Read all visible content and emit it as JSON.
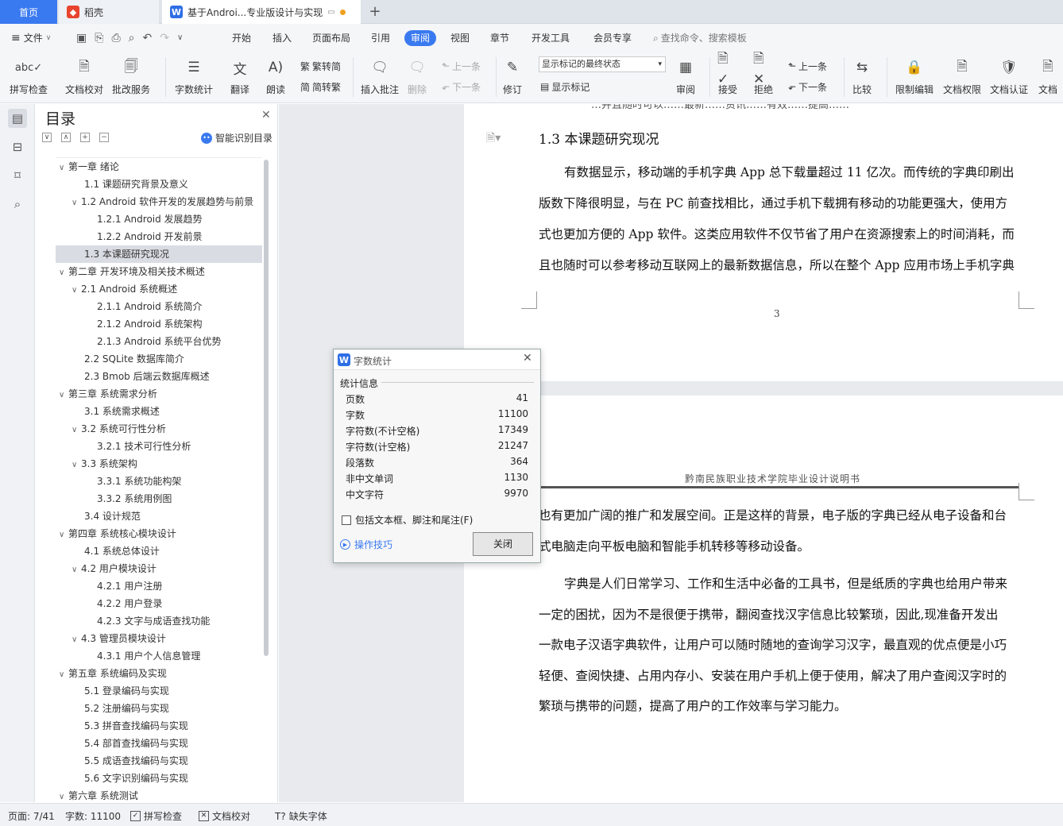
{
  "tabs": {
    "home": "首页",
    "t2": "稻壳",
    "t3": "基于Androi...专业版设计与实现"
  },
  "menu": {
    "file": "文件",
    "items": [
      "开始",
      "插入",
      "页面布局",
      "引用",
      "审阅",
      "视图",
      "章节",
      "开发工具",
      "会员专享"
    ],
    "search": "查找命令、搜索模板"
  },
  "ribbon": {
    "spell": "拼写检查",
    "proof": "文档校对",
    "batch": "批改服务",
    "wordcount": "字数统计",
    "translate": "翻译",
    "read": "朗读",
    "t2s": "繁转简",
    "s2t": "简转繁",
    "insert_comment": "插入批注",
    "delete": "删除",
    "prev": "上一条",
    "next": "下一条",
    "revise": "修订",
    "markup_state": "显示标记的最终状态",
    "show_markup": "显示标记",
    "review": "审阅",
    "accept": "接受",
    "reject": "拒绝",
    "prev2": "上一条",
    "next2": "下一条",
    "compare": "比较",
    "restrict": "限制编辑",
    "perm": "文档权限",
    "auth": "文档认证",
    "doc_more": "文档"
  },
  "toc": {
    "title": "目录",
    "smart": "智能识别目录",
    "items": [
      {
        "text": "第一章 绪论",
        "level": 0,
        "caret": "v"
      },
      {
        "text": "1.1 课题研究背景及意义",
        "level": 1,
        "caret": ""
      },
      {
        "text": "1.2 Android 软件开发的发展趋势与前景",
        "level": 1,
        "caret": "v"
      },
      {
        "text": "1.2.1 Android 发展趋势",
        "level": 2,
        "caret": ""
      },
      {
        "text": "1.2.2 Android 开发前景",
        "level": 2,
        "caret": ""
      },
      {
        "text": "1.3 本课题研究现况",
        "level": 1,
        "caret": "",
        "sel": true
      },
      {
        "text": "第二章 开发环境及相关技术概述",
        "level": 0,
        "caret": "v"
      },
      {
        "text": "2.1 Android 系统概述",
        "level": 1,
        "caret": "v"
      },
      {
        "text": "2.1.1 Android 系统简介",
        "level": 2,
        "caret": ""
      },
      {
        "text": "2.1.2 Android 系统架构",
        "level": 2,
        "caret": ""
      },
      {
        "text": "2.1.3 Android 系统平台优势",
        "level": 2,
        "caret": ""
      },
      {
        "text": "2.2 SQLite 数据库简介",
        "level": 1,
        "caret": ""
      },
      {
        "text": "2.3 Bmob 后端云数据库概述",
        "level": 1,
        "caret": ""
      },
      {
        "text": "第三章 系统需求分析",
        "level": 0,
        "caret": "v"
      },
      {
        "text": "3.1 系统需求概述",
        "level": 1,
        "caret": ""
      },
      {
        "text": "3.2 系统可行性分析",
        "level": 1,
        "caret": "v"
      },
      {
        "text": "3.2.1 技术可行性分析",
        "level": 2,
        "caret": ""
      },
      {
        "text": "3.3 系统架构",
        "level": 1,
        "caret": "v"
      },
      {
        "text": "3.3.1 系统功能构架",
        "level": 2,
        "caret": ""
      },
      {
        "text": "3.3.2 系统用例图",
        "level": 2,
        "caret": ""
      },
      {
        "text": "3.4 设计规范",
        "level": 1,
        "caret": ""
      },
      {
        "text": "第四章 系统核心模块设计",
        "level": 0,
        "caret": "v"
      },
      {
        "text": "4.1 系统总体设计",
        "level": 1,
        "caret": ""
      },
      {
        "text": "4.2 用户模块设计",
        "level": 1,
        "caret": "v"
      },
      {
        "text": "4.2.1 用户注册",
        "level": 2,
        "caret": ""
      },
      {
        "text": "4.2.2 用户登录",
        "level": 2,
        "caret": ""
      },
      {
        "text": "4.2.3 文字与成语查找功能",
        "level": 2,
        "caret": ""
      },
      {
        "text": "4.3 管理员模块设计",
        "level": 1,
        "caret": "v"
      },
      {
        "text": "4.3.1 用户个人信息管理",
        "level": 2,
        "caret": ""
      },
      {
        "text": "第五章 系统编码及实现",
        "level": 0,
        "caret": "v"
      },
      {
        "text": "5.1 登录编码与实现",
        "level": 1,
        "caret": ""
      },
      {
        "text": "5.2 注册编码与实现",
        "level": 1,
        "caret": ""
      },
      {
        "text": "5.3 拼音查找编码与实现",
        "level": 1,
        "caret": ""
      },
      {
        "text": "5.4 部首查找编码与实现",
        "level": 1,
        "caret": ""
      },
      {
        "text": "5.5 成语查找编码与实现",
        "level": 1,
        "caret": ""
      },
      {
        "text": "5.6 文字识别编码与实现",
        "level": 1,
        "caret": ""
      },
      {
        "text": "第六章 系统测试",
        "level": 0,
        "caret": "v"
      }
    ]
  },
  "doc": {
    "top_cut": "…并且随时可以……最新……资讯……有效……提高……",
    "heading": "1.3 本课题研究现况",
    "p1": [
      "有数据显示，移动端的手机字典 App 总下载量超过 11 亿次。而传统的字典印刷出",
      "版数下降很明显，与在 PC 前查找相比，通过手机下载拥有移动的功能更强大，使用方",
      "式也更加方便的 App 软件。这类应用软件不仅节省了用户在资源搜索上的时间消耗，而",
      "且也随时可以参考移动互联网上的最新数据信息，所以在整个 App 应用市场上手机字典"
    ],
    "page_no": "3",
    "header2": "黔南民族职业技术学院毕业设计说明书",
    "p2": [
      "也有更加广阔的推广和发展空间。正是这样的背景，电子版的字典已经从电子设备和台",
      "式电脑走向平板电脑和智能手机转移等移动设备。"
    ],
    "p3": [
      "字典是人们日常学习、工作和生活中必备的工具书，但是纸质的字典也给用户带来",
      "一定的困扰，因为不是很便于携带，翻阅查找汉字信息比较繁琐，因此,现准备开发出",
      "一款电子汉语字典软件，让用户可以随时随地的查询学习汉字，最直观的优点便是小巧",
      "轻便、查阅快捷、占用内存小、安装在用户手机上便于使用，解决了用户查阅汉字时的",
      "繁琐与携带的问题，提高了用户的工作效率与学习能力。"
    ]
  },
  "dialog": {
    "title": "字数统计",
    "section": "统计信息",
    "stats": [
      {
        "label": "页数",
        "value": "41"
      },
      {
        "label": "字数",
        "value": "11100"
      },
      {
        "label": "字符数(不计空格)",
        "value": "17349"
      },
      {
        "label": "字符数(计空格)",
        "value": "21247"
      },
      {
        "label": "段落数",
        "value": "364"
      },
      {
        "label": "非中文单词",
        "value": "1130"
      },
      {
        "label": "中文字符",
        "value": "9970"
      }
    ],
    "include": "包括文本框、脚注和尾注(F)",
    "tips": "操作技巧",
    "close": "关闭"
  },
  "status": {
    "page": "页面: 7/41",
    "words": "字数: 11100",
    "spell": "拼写检查",
    "proof": "文档校对",
    "font": "缺失字体"
  }
}
